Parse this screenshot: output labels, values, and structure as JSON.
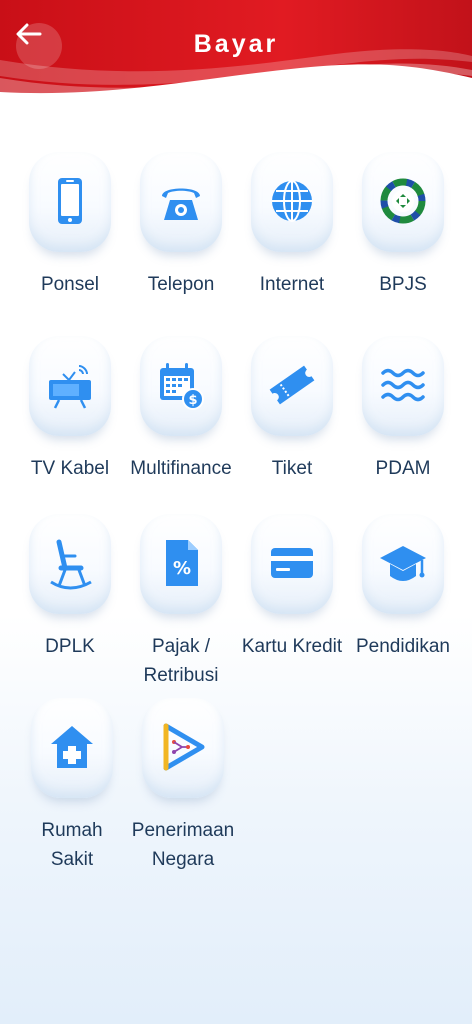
{
  "header": {
    "title": "Bayar",
    "back_icon": "arrow-left-icon"
  },
  "colors": {
    "brand_red": "#d8141c",
    "icon_blue": "#2f8ff0",
    "label_text": "#1f3a5a"
  },
  "menu": [
    {
      "label": "Ponsel",
      "icon": "phone-icon"
    },
    {
      "label": "Telepon",
      "icon": "telephone-icon"
    },
    {
      "label": "Internet",
      "icon": "globe-icon"
    },
    {
      "label": "BPJS",
      "icon": "bpjs-logo-icon"
    },
    {
      "label": "TV Kabel",
      "icon": "tv-icon"
    },
    {
      "label": "Multifinance",
      "icon": "calendar-money-icon"
    },
    {
      "label": "Tiket",
      "icon": "ticket-icon"
    },
    {
      "label": "PDAM",
      "icon": "water-icon"
    },
    {
      "label": "DPLK",
      "icon": "rocking-chair-icon"
    },
    {
      "label_lines": [
        "Pajak /",
        "Retribusi"
      ],
      "icon": "tax-document-icon"
    },
    {
      "label": "Kartu Kredit",
      "icon": "credit-card-icon"
    },
    {
      "label": "Pendidikan",
      "icon": "graduation-cap-icon"
    },
    {
      "label_lines": [
        "Rumah",
        "Sakit"
      ],
      "icon": "hospital-icon"
    },
    {
      "label_lines": [
        "Penerimaan",
        "Negara"
      ],
      "icon": "state-revenue-logo-icon"
    }
  ]
}
